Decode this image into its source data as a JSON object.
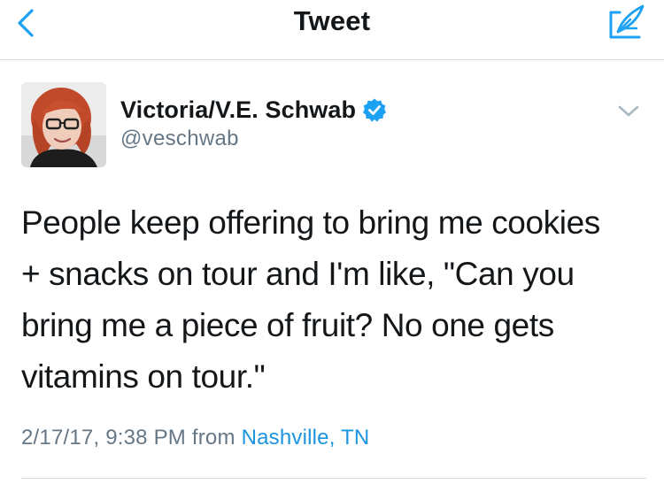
{
  "nav": {
    "title": "Tweet",
    "back_icon": "chevron-left-icon",
    "compose_icon": "compose-feather-icon",
    "accent": "#1da1f2"
  },
  "tweet": {
    "author": {
      "name": "Victoria/V.E. Schwab",
      "handle": "@veschwab",
      "verified": true,
      "verified_color": "#1da1f2"
    },
    "text": "People keep offering to bring me cookies\n+ snacks on tour and I'm like, \"Can you\nbring me a piece of fruit? No one gets\nvitamins on tour.\"",
    "timestamp": "2/17/17, 9:38 PM",
    "from_label": "from",
    "location": "Nashville, TN",
    "location_color": "#1b95e0"
  }
}
